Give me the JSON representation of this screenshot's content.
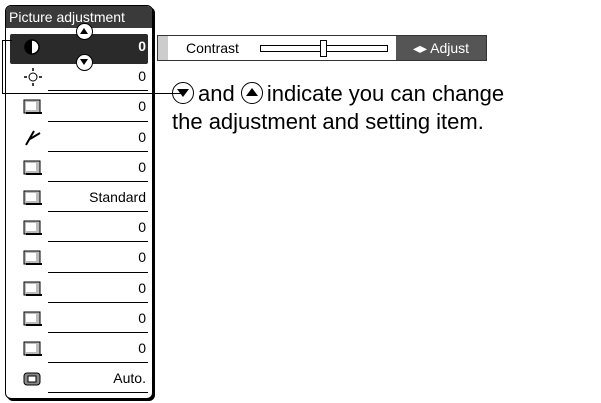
{
  "menu": {
    "title": "Picture adjustment",
    "items": [
      {
        "icon": "contrast-icon",
        "value": "0"
      },
      {
        "icon": "brightness-icon",
        "value": "0"
      },
      {
        "icon": "color-icon",
        "value": "0"
      },
      {
        "icon": "tint-icon",
        "value": "0"
      },
      {
        "icon": "sharpness-icon",
        "value": "0"
      },
      {
        "icon": "color-temperature-icon",
        "value": "Standard"
      },
      {
        "icon": "red-icon",
        "value": "0"
      },
      {
        "icon": "blue-icon",
        "value": "0"
      },
      {
        "icon": "setting-icon-1",
        "value": "0"
      },
      {
        "icon": "setting-icon-2",
        "value": "0"
      },
      {
        "icon": "setting-icon-3",
        "value": "0"
      },
      {
        "icon": "auto-icon",
        "value": "Auto."
      }
    ]
  },
  "contrast_bar": {
    "label": "Contrast",
    "adjust_label": "Adjust",
    "level": 0.5
  },
  "note": {
    "line1_mid": "and",
    "line1_end": "indicate you can change",
    "line2": "the adjustment and setting item."
  }
}
